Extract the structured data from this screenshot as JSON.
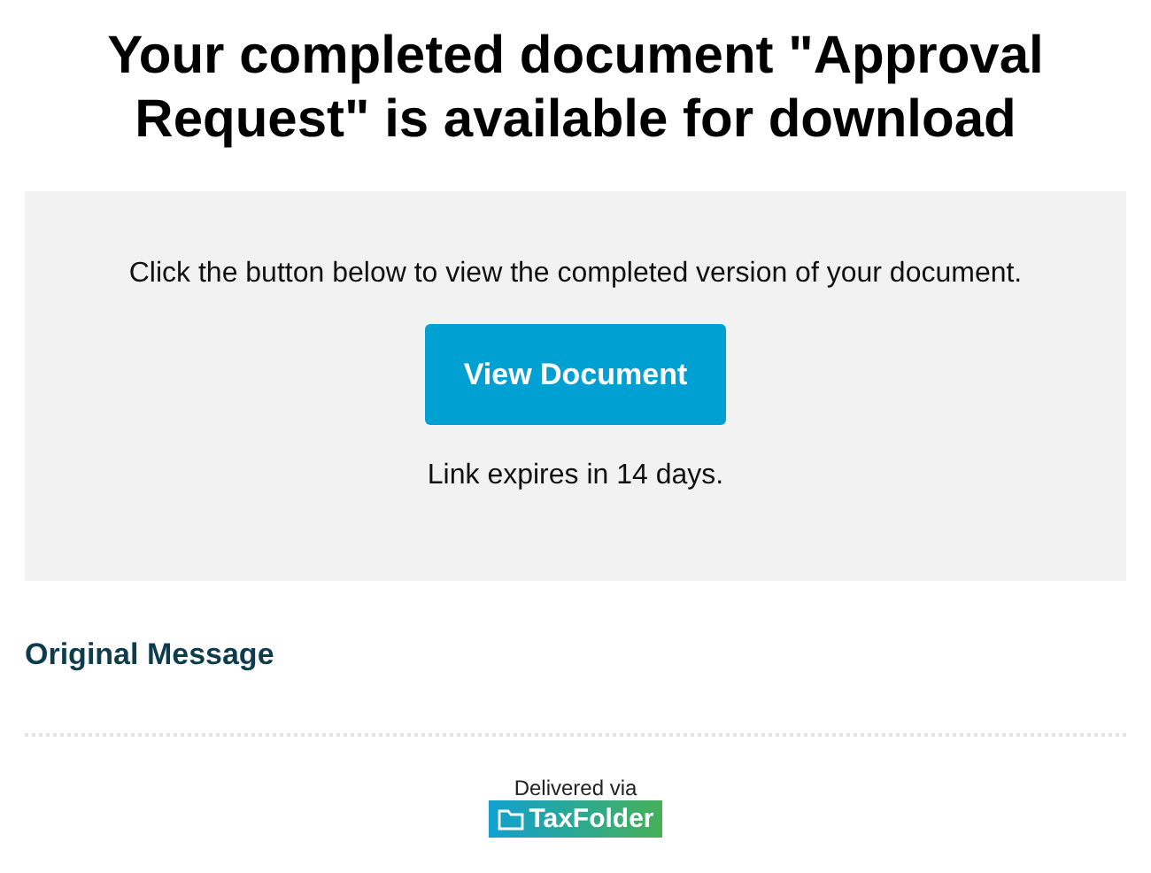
{
  "heading": "Your completed document \"Approval Request\" is available for download",
  "panel": {
    "instruction": "Click the button below to view the completed version of your document.",
    "button": "View Document",
    "expiry": "Link expires in 14 days."
  },
  "original_message": "Original Message",
  "footer": {
    "delivered_via": "Delivered via",
    "logo": "TaxFolder"
  }
}
